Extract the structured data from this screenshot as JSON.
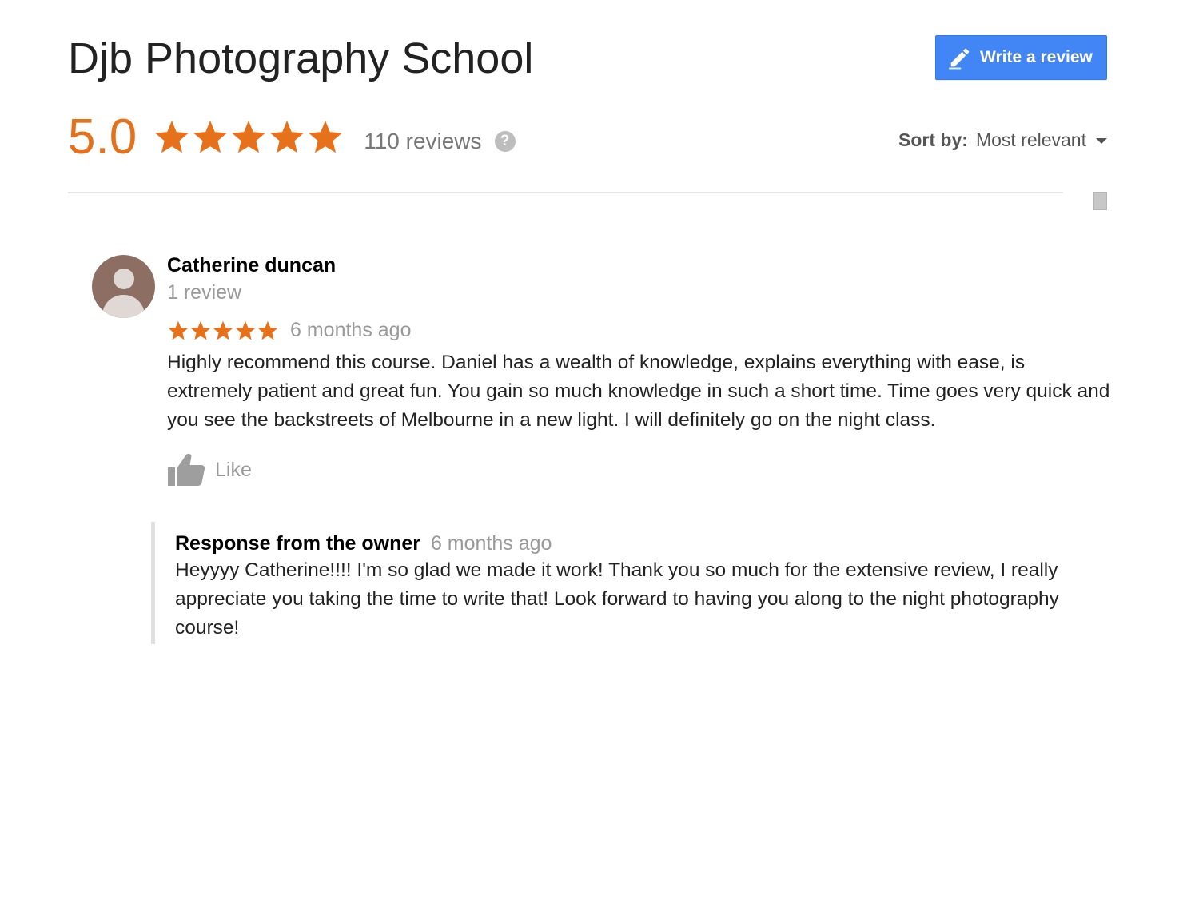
{
  "header": {
    "title": "Djb Photography School",
    "write_review_label": "Write a review",
    "pencil_icon": "pencil-icon"
  },
  "summary": {
    "score": "5.0",
    "stars": 5,
    "review_count": "110 reviews",
    "help_glyph": "?"
  },
  "sort": {
    "label": "Sort by:",
    "value": "Most relevant"
  },
  "review": {
    "author": "Catherine duncan",
    "author_meta": "1 review",
    "stars": 5,
    "time": "6 months ago",
    "text": "Highly recommend this course.  Daniel has a wealth of knowledge, explains everything with ease, is extremely patient and great fun.  You gain so much knowledge in such a short time. Time goes very quick and you see the backstreets of Melbourne in a new light.  I will definitely go on the night class.",
    "like_label": "Like"
  },
  "owner_response": {
    "label": "Response from the owner",
    "time": "6 months ago",
    "text": "Heyyyy Catherine!!!! I'm so glad we made it work! Thank you so much for the extensive review, I really appreciate you taking the time to write that! Look forward to having you along to the night photography course!"
  },
  "colors": {
    "star": "#e7711b",
    "accent": "#4285f4",
    "muted": "#999999"
  }
}
